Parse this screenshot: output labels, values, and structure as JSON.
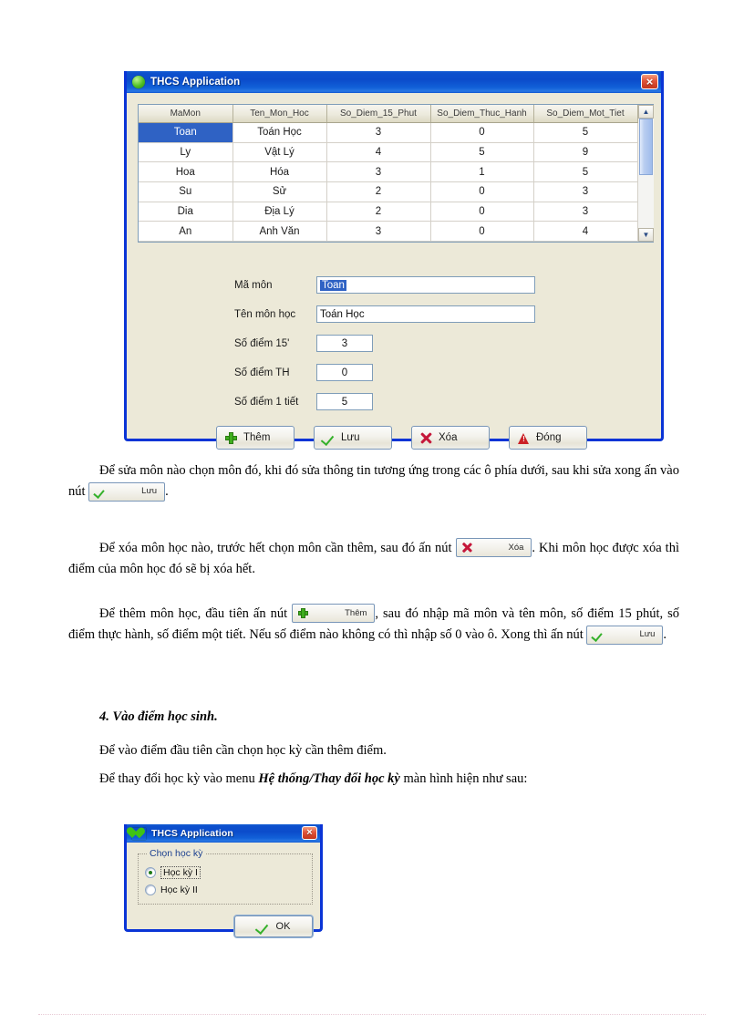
{
  "main_dialog": {
    "title": "THCS Application",
    "title_icon": "green-circle-icon",
    "close_label": "×",
    "grid": {
      "headers": [
        "MaMon",
        "Ten_Mon_Hoc",
        "So_Diem_15_Phut",
        "So_Diem_Thuc_Hanh",
        "So_Diem_Mot_Tiet"
      ],
      "rows": [
        {
          "mamon": "Toan",
          "ten": "Toán Học",
          "d15": "3",
          "dth": "0",
          "d1t": "5",
          "selected": true
        },
        {
          "mamon": "Ly",
          "ten": "Vật Lý",
          "d15": "4",
          "dth": "5",
          "d1t": "9",
          "selected": false
        },
        {
          "mamon": "Hoa",
          "ten": "Hóa",
          "d15": "3",
          "dth": "1",
          "d1t": "5",
          "selected": false
        },
        {
          "mamon": "Su",
          "ten": "Sử",
          "d15": "2",
          "dth": "0",
          "d1t": "3",
          "selected": false
        },
        {
          "mamon": "Dia",
          "ten": "Địa Lý",
          "d15": "2",
          "dth": "0",
          "d1t": "3",
          "selected": false
        },
        {
          "mamon": "An",
          "ten": "Anh Văn",
          "d15": "3",
          "dth": "0",
          "d1t": "4",
          "selected": false
        }
      ],
      "scroll_up": "▲",
      "scroll_down": "▼"
    },
    "form": {
      "ma_mon_label": "Mã môn",
      "ma_mon_value": "Toan",
      "ten_mon_label": "Tên môn học",
      "ten_mon_value": "Toán Học",
      "diem15_label": "Số điểm 15'",
      "diem15_value": "3",
      "diemth_label": "Số điểm TH",
      "diemth_value": "0",
      "diem1tiet_label": "Số điểm 1 tiết",
      "diem1tiet_value": "5"
    },
    "buttons": {
      "add": "Thêm",
      "save": "Lưu",
      "delete": "Xóa",
      "close": "Đóng"
    }
  },
  "body_text": {
    "p1_a": "Để sửa môn nào chọn môn đó, khi đó sửa thông tin tương ứng trong các ô phía dưới, sau khi sửa xong ấn vào nút ",
    "p1_btn": "Lưu",
    "p1_b": ".",
    "p2_a": "Để xóa môn học nào, trước hết chọn môn cần thêm, sau đó ấn nút ",
    "p2_btn": "Xóa",
    "p2_b": ". Khi môn học được xóa thì điểm của môn học đó sẽ bị xóa hết.",
    "p3_a": "Để thêm môn học, đầu tiên ấn nút ",
    "p3_btn": "Thêm",
    "p3_b": ", sau đó nhập mã môn và tên môn, số điểm 15 phút, số điểm thực hành, số điểm một tiết. Nếu số điểm nào không có thì nhập số 0 vào ô. Xong thì ấn nút ",
    "p3_btn2": "Lưu",
    "p3_c": ".",
    "section_heading": "4.  Vào điểm học sinh.",
    "p4": "Để vào điểm đầu tiên cần chọn học kỳ cần thêm điểm.",
    "p5_a": "Để thay đổi học kỳ vào menu ",
    "p5_bold": "Hệ thống/Thay đổi học kỳ",
    "p5_b": " màn hình hiện như sau:"
  },
  "semester_dialog": {
    "title": "THCS Application",
    "title_icon": "green-heart-icon",
    "close_label": "×",
    "groupbox_title": "Chọn học kỳ",
    "radio1": "Học kỳ I",
    "radio2": "Học kỳ II",
    "selected": "Học kỳ I",
    "ok": "OK"
  },
  "colors": {
    "titlebar_blue": "#0b4ccb",
    "dialog_border": "#0a34d6",
    "dialog_face": "#ece9d8",
    "selection_blue": "#2f62c4",
    "close_red": "#c3351c",
    "icon_green": "#3fae1e",
    "icon_red": "#c5173a",
    "groupbox_label": "#1a3f8f"
  }
}
